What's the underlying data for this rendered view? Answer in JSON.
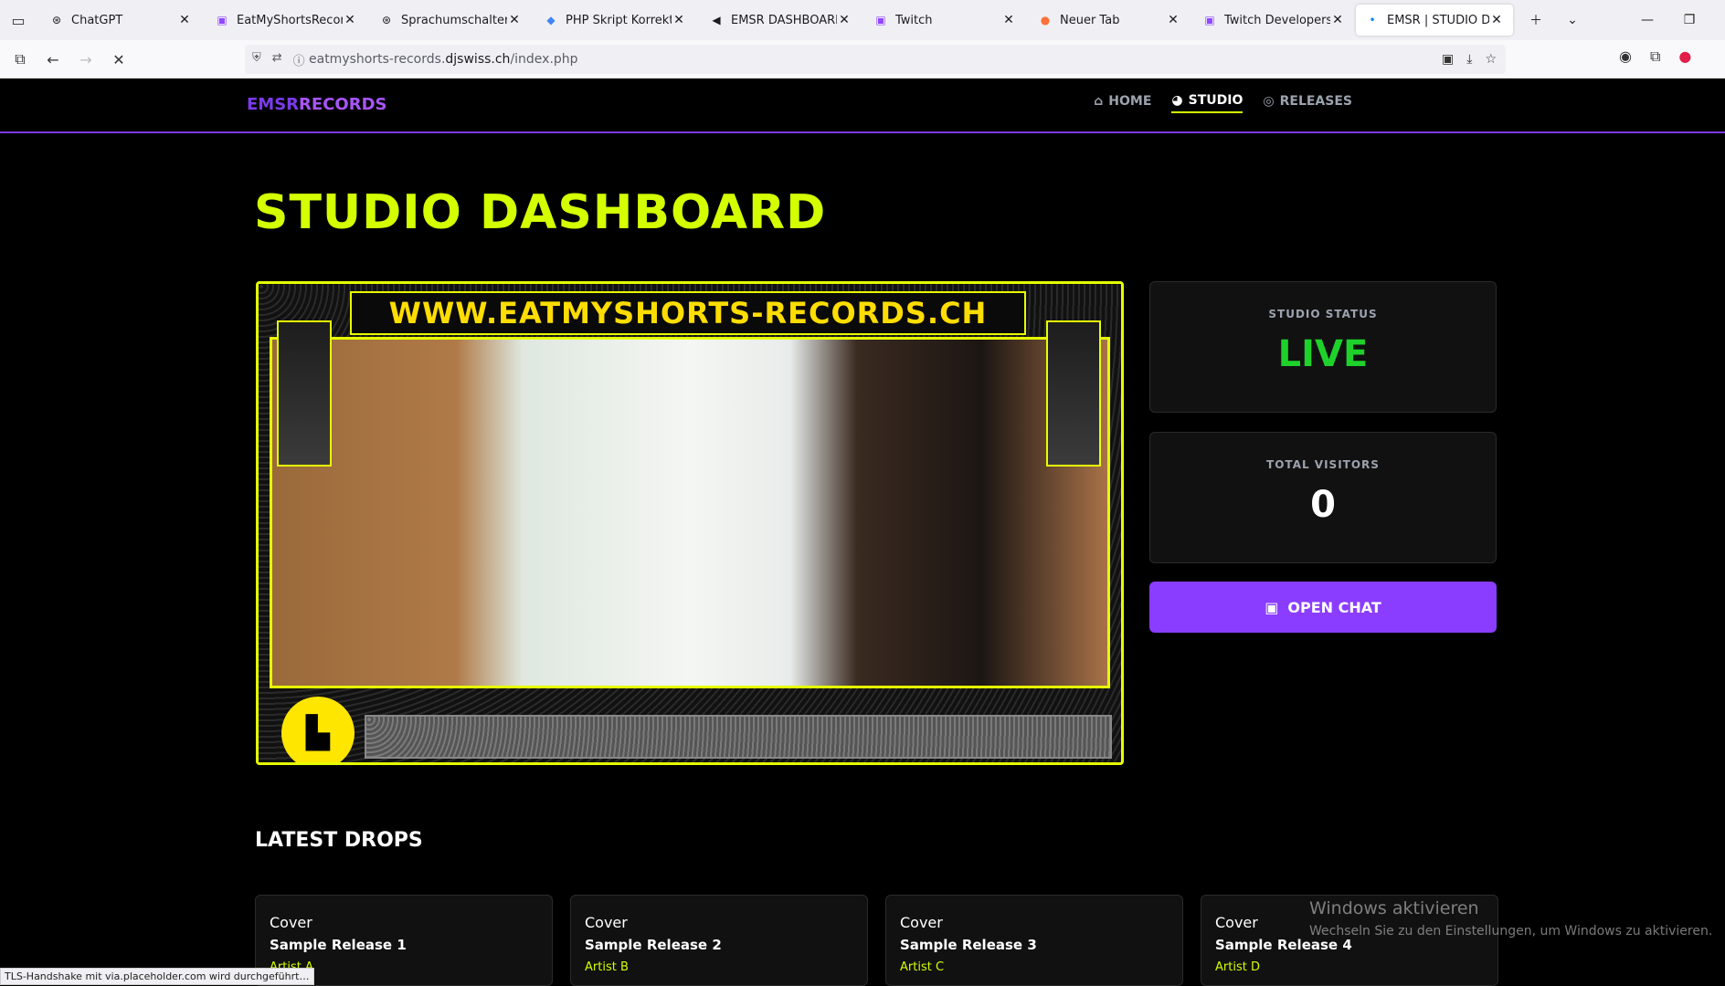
{
  "browser": {
    "tabs": [
      {
        "title": "ChatGPT",
        "icon": "chatgpt-icon"
      },
      {
        "title": "EatMyShortsRecords -",
        "icon": "twitch-icon"
      },
      {
        "title": "Sprachumschalter Integ",
        "icon": "chatgpt-icon"
      },
      {
        "title": "PHP Skript Korrekturen",
        "icon": "gemini-icon"
      },
      {
        "title": "EMSR DASHBOARD",
        "icon": "speaker-icon"
      },
      {
        "title": "Twitch",
        "icon": "twitch-icon"
      },
      {
        "title": "Neuer Tab",
        "icon": "firefox-icon"
      },
      {
        "title": "Twitch Developers",
        "icon": "twitch-icon"
      },
      {
        "title": "EMSR | STUDIO DASHB",
        "icon": "loading-dot-icon"
      }
    ],
    "url_prefix": "eatmyshorts-records.",
    "url_host": "djswiss.ch",
    "url_path": "/index.php"
  },
  "site": {
    "logo_part1": "EMSR",
    "logo_part2": "RECORDS",
    "nav": [
      {
        "label": "HOME",
        "icon": "home-icon"
      },
      {
        "label": "STUDIO",
        "icon": "studio-icon"
      },
      {
        "label": "RELEASES",
        "icon": "disc-icon"
      }
    ],
    "active_nav": "STUDIO",
    "page_title": "STUDIO DASHBOARD",
    "player_banner": "WWW.EATMYSHORTS-RECORDS.CH",
    "status_label": "STUDIO STATUS",
    "status_value": "LIVE",
    "visitors_label": "TOTAL VISITORS",
    "visitors_value": "0",
    "chat_button": "OPEN CHAT",
    "section_title": "LATEST DROPS",
    "drops": [
      {
        "cover": "Cover",
        "name": "Sample Release 1",
        "artist": "Artist A"
      },
      {
        "cover": "Cover",
        "name": "Sample Release 2",
        "artist": "Artist B"
      },
      {
        "cover": "Cover",
        "name": "Sample Release 3",
        "artist": "Artist C"
      },
      {
        "cover": "Cover",
        "name": "Sample Release 4",
        "artist": "Artist D"
      }
    ]
  },
  "status_bar": "TLS-Handshake mit via.placeholder.com wird durchgeführt…",
  "watermark": {
    "line1": "Windows aktivieren",
    "line2": "Wechseln Sie zu den Einstellungen, um Windows zu aktivieren."
  },
  "colors": {
    "accent": "#d4ff00",
    "brand_purple": "#8b3dff",
    "live_green": "#1fd12b"
  }
}
